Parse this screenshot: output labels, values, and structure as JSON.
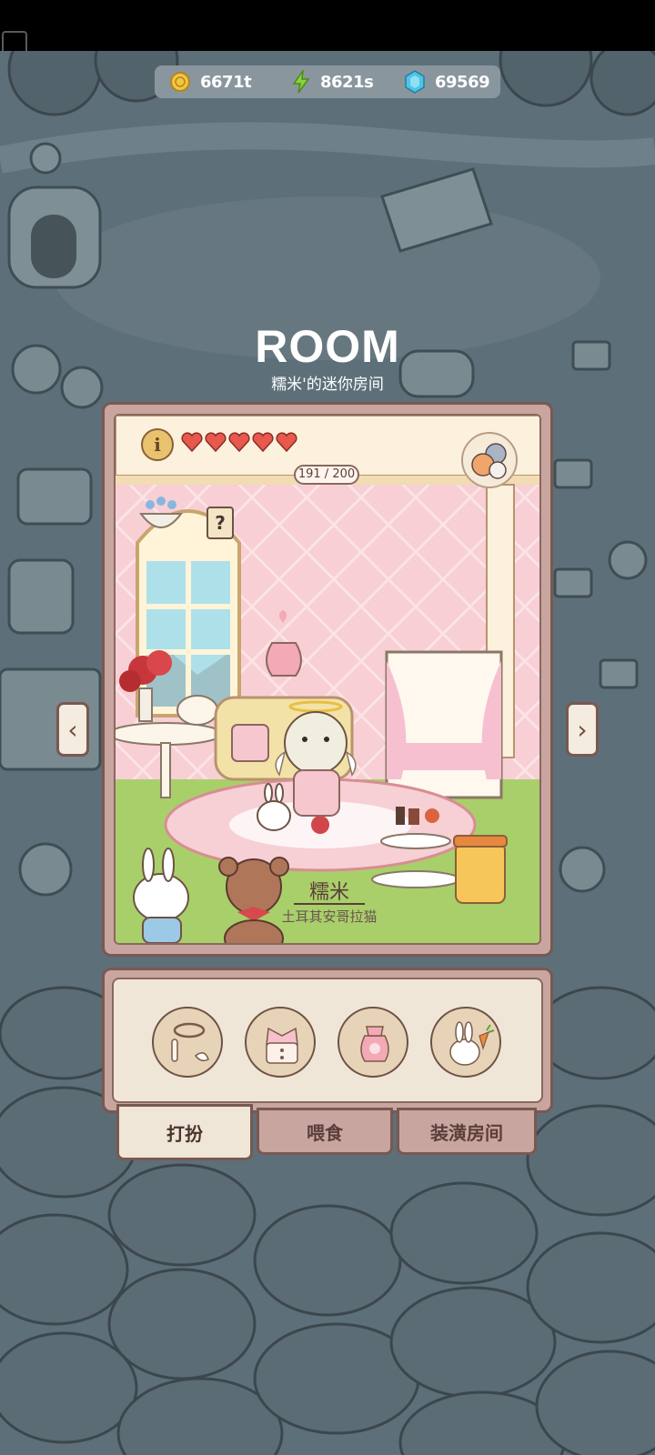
{
  "currency": {
    "coins": "6671t",
    "energy": "8621s",
    "gems": "69569"
  },
  "title": "ROOM",
  "subtitle": "糯米'的迷你房间",
  "room": {
    "hp": "191 / 200",
    "hearts_filled": 5,
    "help_mark": "?",
    "info_mark": "i",
    "cat_name": "糯米",
    "cat_breed": "土耳其安哥拉猫"
  },
  "nav": {
    "prev": "‹",
    "next": "›"
  },
  "items": [
    {
      "icon": "halo-icon"
    },
    {
      "icon": "pink-outfit-icon"
    },
    {
      "icon": "pink-pouch-icon"
    },
    {
      "icon": "bunny-carrot-icon"
    }
  ],
  "tabs": [
    {
      "label": "打扮",
      "active": true
    },
    {
      "label": "喂食",
      "active": false
    },
    {
      "label": "装潢房间",
      "active": false
    }
  ],
  "colors": {
    "background": "#5d6f79",
    "panel": "#c9a59f",
    "panel_border": "#7a5852",
    "wall": "#f7cfd4",
    "floor": "#a9cf6a"
  }
}
